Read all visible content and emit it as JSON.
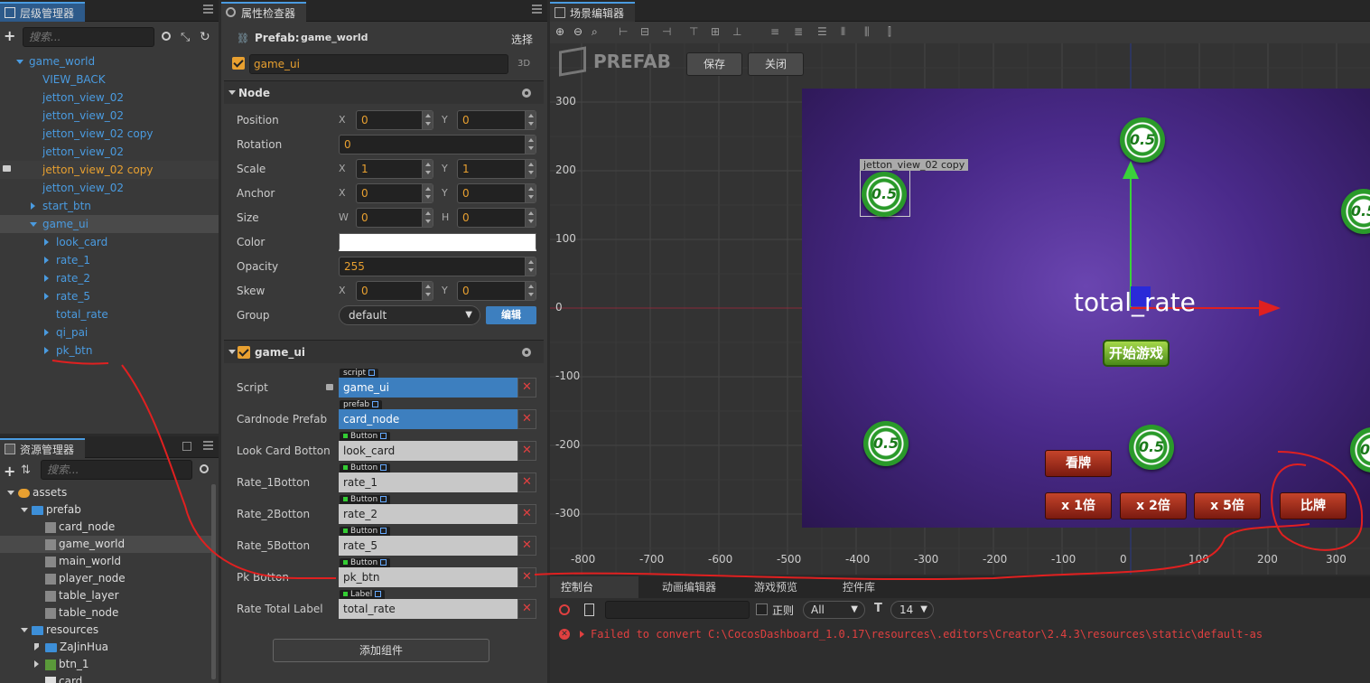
{
  "hierarchy": {
    "tab": "层级管理器",
    "search_placeholder": "搜索...",
    "nodes": [
      {
        "label": "game_world",
        "depth": 0,
        "arrow": "down"
      },
      {
        "label": "VIEW_BACK",
        "depth": 1,
        "arrow": ""
      },
      {
        "label": "jetton_view_02",
        "depth": 1,
        "arrow": ""
      },
      {
        "label": "jetton_view_02",
        "depth": 1,
        "arrow": ""
      },
      {
        "label": "jetton_view_02 copy",
        "depth": 1,
        "arrow": ""
      },
      {
        "label": "jetton_view_02",
        "depth": 1,
        "arrow": ""
      },
      {
        "label": "jetton_view_02 copy",
        "depth": 1,
        "arrow": "",
        "highlight": true
      },
      {
        "label": "jetton_view_02",
        "depth": 1,
        "arrow": ""
      },
      {
        "label": "start_btn",
        "depth": 1,
        "arrow": "right"
      },
      {
        "label": "game_ui",
        "depth": 1,
        "arrow": "down",
        "selected": true
      },
      {
        "label": "look_card",
        "depth": 2,
        "arrow": "right"
      },
      {
        "label": "rate_1",
        "depth": 2,
        "arrow": "right"
      },
      {
        "label": "rate_2",
        "depth": 2,
        "arrow": "right"
      },
      {
        "label": "rate_5",
        "depth": 2,
        "arrow": "right"
      },
      {
        "label": "total_rate",
        "depth": 2,
        "arrow": ""
      },
      {
        "label": "qi_pai",
        "depth": 2,
        "arrow": "right"
      },
      {
        "label": "pk_btn",
        "depth": 2,
        "arrow": "right"
      }
    ]
  },
  "assets": {
    "tab": "资源管理器",
    "search_placeholder": "搜索...",
    "items": [
      {
        "label": "assets",
        "depth": 0,
        "kind": "db"
      },
      {
        "label": "prefab",
        "depth": 1,
        "kind": "folder"
      },
      {
        "label": "card_node",
        "depth": 2,
        "kind": "prefab"
      },
      {
        "label": "game_world",
        "depth": 2,
        "kind": "prefab",
        "selected": true
      },
      {
        "label": "main_world",
        "depth": 2,
        "kind": "prefab"
      },
      {
        "label": "player_node",
        "depth": 2,
        "kind": "prefab"
      },
      {
        "label": "table_layer",
        "depth": 2,
        "kind": "prefab"
      },
      {
        "label": "table_node",
        "depth": 2,
        "kind": "prefab"
      },
      {
        "label": "resources",
        "depth": 1,
        "kind": "folder"
      },
      {
        "label": "ZaJinHua",
        "depth": 2,
        "kind": "folder"
      },
      {
        "label": "btn_1",
        "depth": 2,
        "kind": "image"
      },
      {
        "label": "card",
        "depth": 2,
        "kind": "image"
      }
    ]
  },
  "inspector": {
    "tab": "属性检查器",
    "prefab_label": "Prefab:",
    "prefab_name": "game_world",
    "select_btn": "选择",
    "node_name": "game_ui",
    "mode": "3D",
    "node_section": "Node",
    "position_label": "Position",
    "pos_x": "0",
    "pos_y": "0",
    "rotation_label": "Rotation",
    "rotation": "0",
    "scale_label": "Scale",
    "scale_x": "1",
    "scale_y": "1",
    "anchor_label": "Anchor",
    "anchor_x": "0",
    "anchor_y": "0",
    "size_label": "Size",
    "size_w": "0",
    "size_h": "0",
    "color_label": "Color",
    "opacity_label": "Opacity",
    "opacity": "255",
    "skew_label": "Skew",
    "skew_x": "0",
    "skew_y": "0",
    "group_label": "Group",
    "group": "default",
    "edit_btn": "编辑",
    "axis_x": "X",
    "axis_y": "Y",
    "axis_w": "W",
    "axis_h": "H",
    "component_section": "game_ui",
    "props": [
      {
        "label": "Script",
        "tag": "script",
        "value": "game_ui",
        "blue": true
      },
      {
        "label": "Cardnode Prefab",
        "tag": "prefab",
        "value": "card_node",
        "blue": true
      },
      {
        "label": "Look Card Botton",
        "tag": "Button",
        "value": "look_card",
        "blue": false
      },
      {
        "label": "Rate_1Botton",
        "tag": "Button",
        "value": "rate_1",
        "blue": false
      },
      {
        "label": "Rate_2Botton",
        "tag": "Button",
        "value": "rate_2",
        "blue": false
      },
      {
        "label": "Rate_5Botton",
        "tag": "Button",
        "value": "rate_5",
        "blue": false
      },
      {
        "label": "Pk Botton",
        "tag": "Button",
        "value": "pk_btn",
        "blue": false
      },
      {
        "label": "Rate Total Label",
        "tag": "Label",
        "value": "total_rate",
        "blue": false
      }
    ],
    "add_component": "添加组件"
  },
  "scene": {
    "tab": "场景编辑器",
    "prefab_title": "PREFAB",
    "save_btn": "保存",
    "close_btn": "关闭",
    "y_ticks": [
      "300",
      "200",
      "100",
      "0",
      "-100",
      "-200",
      "-300"
    ],
    "x_ticks": [
      "-800",
      "-700",
      "-600",
      "-500",
      "-400",
      "-300",
      "-200",
      "-100",
      "0",
      "100",
      "200",
      "300"
    ],
    "selection_label": "jetton_view_02 copy",
    "chip_text": "0.5",
    "total_rate_text": "total_rate",
    "start_game": "开始游戏",
    "look_card": "看牌",
    "rate_1": "x 1倍",
    "rate_2": "x 2倍",
    "rate_5": "x 5倍",
    "pk": "比牌"
  },
  "console": {
    "tabs": [
      "控制台",
      "动画编辑器",
      "游戏预览",
      "控件库"
    ],
    "regex_label": "正则",
    "level": "All",
    "font_size": "14",
    "error_line": "Failed to convert C:\\CocosDashboard_1.0.17\\resources\\.editors\\Creator\\2.4.3\\resources\\static\\default-as"
  }
}
